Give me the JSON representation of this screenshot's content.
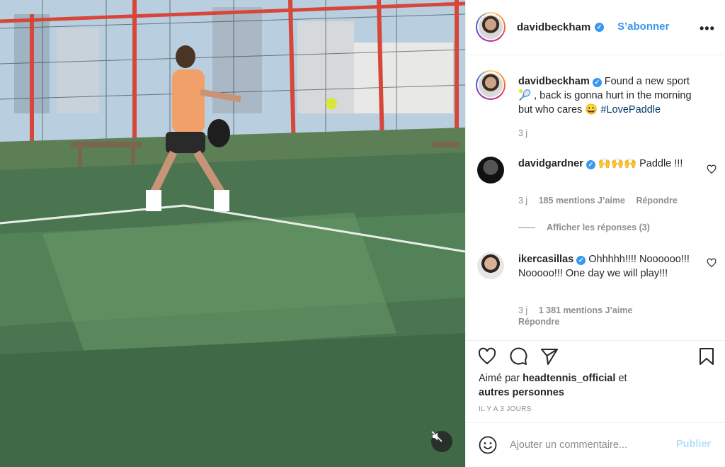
{
  "post": {
    "author": "davidbeckham",
    "follow_label": "S’abonner",
    "more_label": "•••",
    "caption_text": "Found a new sport 🎾 , back is gonna hurt in the morning but who cares 😀",
    "caption_hashtag": "#LovePaddle",
    "caption_age": "3 j"
  },
  "comments": [
    {
      "author": "davidgardner",
      "text": "🙌🙌🙌 Paddle !!!",
      "age": "3 j",
      "likes": "185 mentions J’aime",
      "reply_label": "Répondre"
    },
    {
      "author": "ikercasillas",
      "text": "Ohhhhh!!!! Noooooo!!! Nooooo!!! One day we will play!!!",
      "age": "3 j",
      "likes": "1 381 mentions J’aime",
      "reply_label": "Répondre"
    }
  ],
  "replies_toggle": "Afficher les réponses (3)",
  "liked_by": {
    "prefix": "Aimé par",
    "user": "headtennis_official",
    "mid": "et",
    "others": "autres personnes"
  },
  "timestamp": "IL Y A 3 JOURS",
  "add_comment": {
    "placeholder": "Ajouter un commentaire...",
    "publish_label": "Publier"
  },
  "icons": {
    "verified": "verified-badge-icon",
    "like": "heart-icon",
    "comment": "comment-icon",
    "share": "paper-plane-icon",
    "save": "bookmark-icon",
    "emoji": "smiley-icon",
    "mute": "speaker-muted-icon"
  },
  "colors": {
    "link_blue": "#3897f0",
    "hashtag": "#00376b",
    "muted_text": "#8e8e8e",
    "publish_disabled": "#b2dffc"
  }
}
